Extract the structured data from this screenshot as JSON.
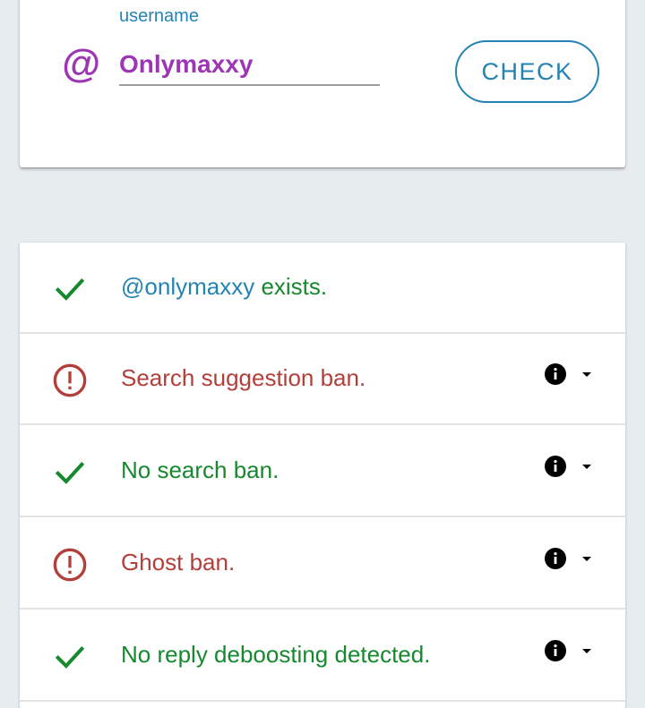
{
  "form": {
    "label": "username",
    "at_symbol": "@",
    "username_value": "Onlymaxxy",
    "check_label": "CHECK"
  },
  "results": [
    {
      "status": "ok",
      "handle": "@onlymaxxy",
      "text": " exists.",
      "has_details": false
    },
    {
      "status": "warn",
      "text": "Search suggestion ban.",
      "has_details": true
    },
    {
      "status": "ok",
      "text": "No search ban.",
      "has_details": true
    },
    {
      "status": "warn",
      "text": "Ghost ban.",
      "has_details": true
    },
    {
      "status": "ok",
      "text": "No reply deboosting detected.",
      "has_details": true
    }
  ],
  "icons": {
    "check": "check-icon",
    "warn": "alert-circle-icon",
    "info": "info-icon",
    "expand": "caret-down-icon"
  },
  "colors": {
    "background": "#e7ecef",
    "primary": "#2383b3",
    "accent_purple": "#9c36b5",
    "ok_green": "#16892f",
    "warn_red": "#b33f3a"
  }
}
